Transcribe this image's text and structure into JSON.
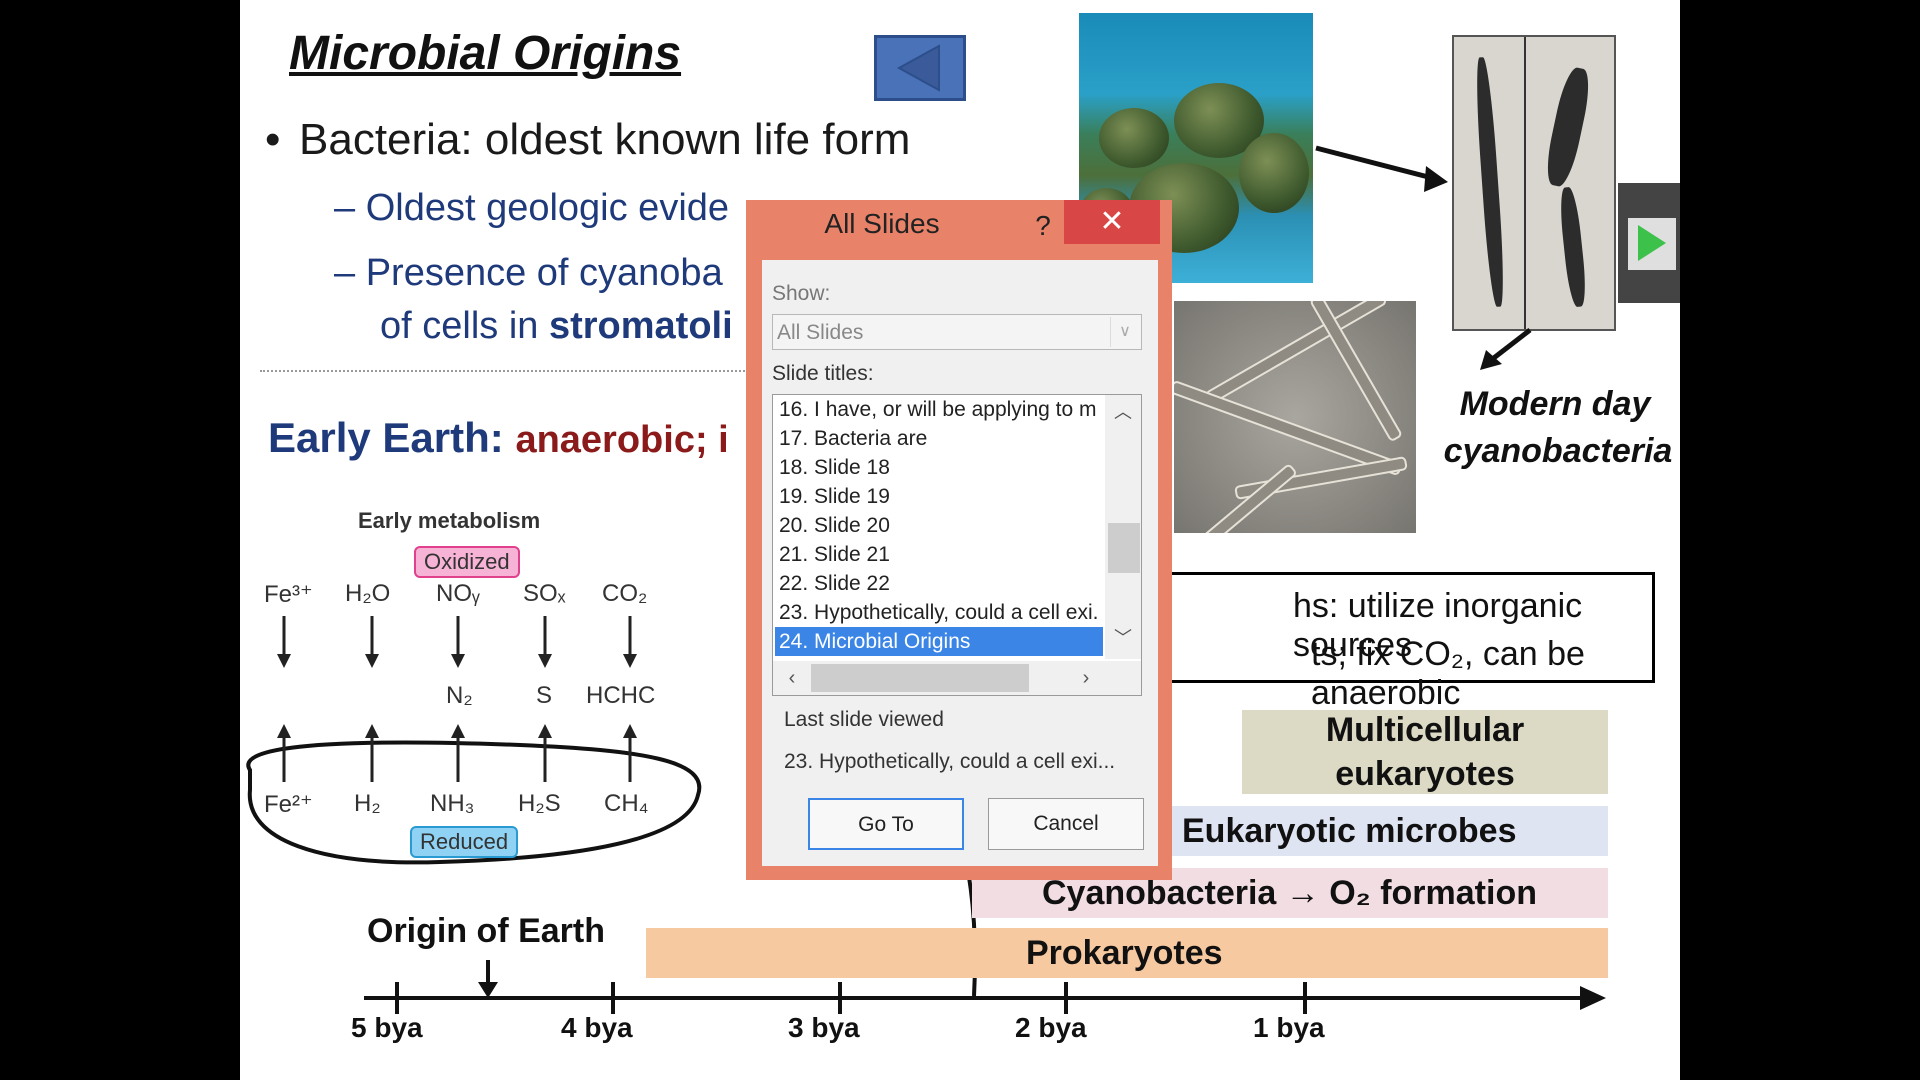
{
  "slide": {
    "title": "Microbial Origins",
    "bullet": "Bacteria:  oldest known life form",
    "sub1": "– Oldest geologic evide",
    "sub2": "– Presence of cyanoba",
    "sub3_prefix": "of cells in ",
    "sub3_bold": "stromatoli",
    "early_label": "Early Earth:",
    "early_desc": "anaerobic; i",
    "caption_line1": "Modern day",
    "caption_line2": "cyanobacteria",
    "box_line1": "hs:  utilize inorganic sources",
    "box_line2": "ts; fix CO₂, can be anaerobic",
    "bands": {
      "multicellular": "Multicellular eukaryotes",
      "eukaryotic": "Eukaryotic microbes",
      "cyanobacteria": "Cyanobacteria → O₂ formation",
      "prokaryotes": "Prokaryotes"
    },
    "origin_label": "Origin of Earth",
    "ticks": [
      "5 bya",
      "4 bya",
      "3 bya",
      "2 bya",
      "1 bya"
    ],
    "metabolism": {
      "title": "Early metabolism",
      "oxidized": "Oxidized",
      "reduced": "Reduced",
      "oxidized_species": [
        "Fe³⁺",
        "H₂O",
        "NOᵧ",
        "SOₓ",
        "CO₂"
      ],
      "intermediate_species": [
        "N₂",
        "S",
        "HCHC"
      ],
      "reduced_species": [
        "Fe²⁺",
        "H₂",
        "NH₃",
        "H₂S",
        "CH₄"
      ]
    }
  },
  "dialog": {
    "title": "All Slides",
    "help": "?",
    "close": "✕",
    "show_label": "Show:",
    "show_value": "All Slides",
    "titles_label": "Slide titles:",
    "items": [
      "16. I have, or will be applying to m",
      "17. Bacteria are",
      "18. Slide 18",
      "19. Slide 19",
      "20. Slide 20",
      "21. Slide 21",
      "22. Slide 22",
      "23. Hypothetically, could a cell exi.",
      "24. Microbial Origins"
    ],
    "selected_index": 8,
    "last_viewed_label": "Last slide viewed",
    "last_viewed_value": "23. Hypothetically, could a cell exi...",
    "goto_label": "Go To",
    "cancel_label": "Cancel"
  },
  "colors": {
    "dialog_frame": "#e8836a",
    "close_button": "#d94646",
    "selection": "#3a85e6",
    "title_blue": "#1f3a7a",
    "anaerobic_red": "#8b1a1a",
    "prokaryotes_band": "#f7c9a0",
    "cyanobacteria_band": "#f2dde3",
    "eukaryotic_band": "#dfe4f2",
    "multicellular_band": "#dcd9c4"
  }
}
